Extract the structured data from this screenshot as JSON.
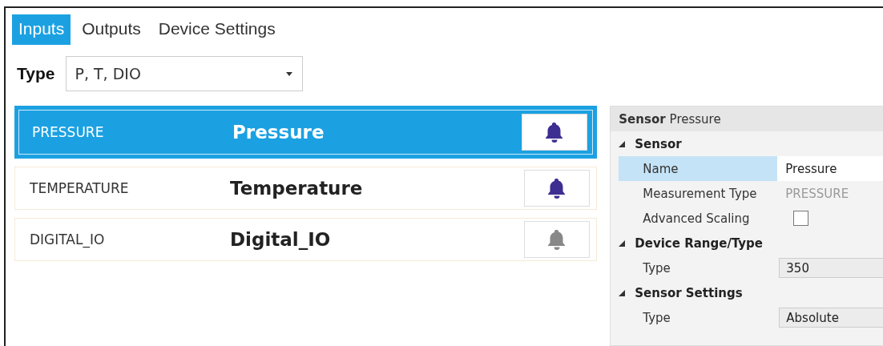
{
  "tabs": [
    {
      "label": "Inputs",
      "selected": true
    },
    {
      "label": "Outputs",
      "selected": false
    },
    {
      "label": "Device Settings",
      "selected": false
    }
  ],
  "type_filter": {
    "label": "Type",
    "value": "P, T, DIO"
  },
  "sensors": [
    {
      "id": "PRESSURE",
      "name": "Pressure",
      "selected": true,
      "alarm_enabled": true
    },
    {
      "id": "TEMPERATURE",
      "name": "Temperature",
      "selected": false,
      "alarm_enabled": true
    },
    {
      "id": "DIGITAL_IO",
      "name": "Digital_IO",
      "selected": false,
      "alarm_enabled": false
    }
  ],
  "properties": {
    "header_label": "Sensor",
    "header_value": "Pressure",
    "categories": [
      {
        "title": "Sensor",
        "expanded": true,
        "rows": [
          {
            "kind": "text",
            "label": "Name",
            "value": "Pressure",
            "selected": true
          },
          {
            "kind": "readonly",
            "label": "Measurement Type",
            "value": "PRESSURE",
            "selected": false
          },
          {
            "kind": "checkbox",
            "label": "Advanced Scaling",
            "checked": false,
            "selected": false
          }
        ]
      },
      {
        "title": "Device Range/Type",
        "expanded": true,
        "rows": [
          {
            "kind": "field",
            "label": "Type",
            "value": "350",
            "selected": false
          }
        ]
      },
      {
        "title": "Sensor Settings",
        "expanded": true,
        "rows": [
          {
            "kind": "field",
            "label": "Type",
            "value": "Absolute",
            "selected": false
          }
        ]
      }
    ]
  }
}
